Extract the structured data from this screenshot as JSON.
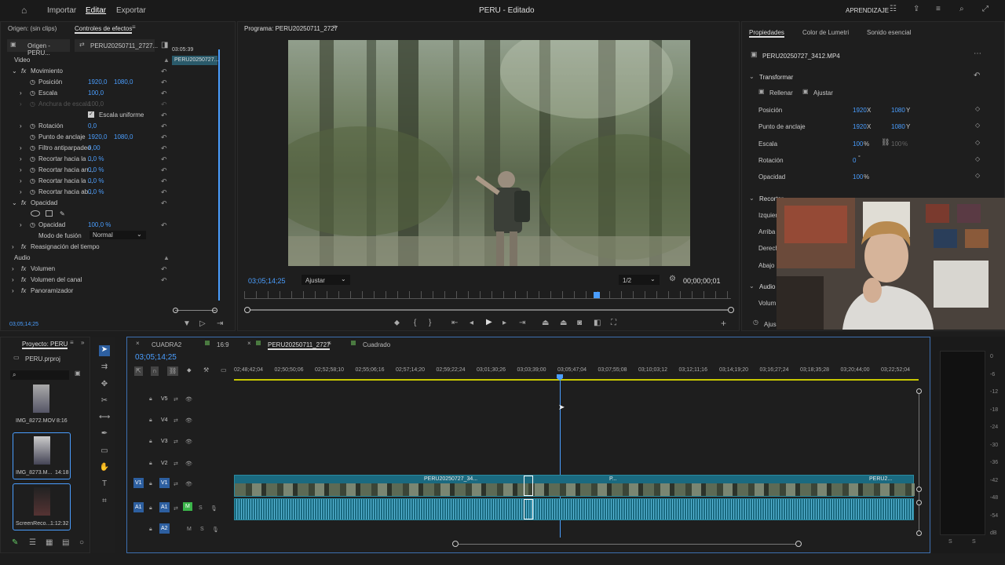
{
  "topbar": {
    "home_icon": "home-icon",
    "menu_import": "Importar",
    "menu_edit": "Editar",
    "menu_export": "Exportar",
    "title": "PERU - Editado",
    "learning": "APRENDIZAJE"
  },
  "source_panel": {
    "origin": "Origen: (sin clips)",
    "tab_effects": "Controles de efectos",
    "tab_source": "Origen - PERU...",
    "tab_seq": "PERU20250711_2727...",
    "mini_time": "03:05:39",
    "mini_clip": "PERU20250727...",
    "video_label": "Video",
    "movement": "Movimiento",
    "position": "Posición",
    "pos_x": "1920,0",
    "pos_y": "1080,0",
    "scale": "Escala",
    "scale_val": "100,0",
    "width_scale": "Anchura de escala",
    "width_val": "100,0",
    "uniform_scale": "Escala uniforme",
    "rotation": "Rotación",
    "rotation_val": "0,0",
    "anchor": "Punto de anclaje",
    "anchor_x": "1920,0",
    "anchor_y": "1080,0",
    "antiflicker": "Filtro antiparpadeo",
    "antiflicker_val": "0,00",
    "crop_left": "Recortar hacia la ...",
    "crop_left_val": "0,0 %",
    "crop_right": "Recortar hacia arr...",
    "crop_right_val": "0,0 %",
    "crop_top": "Recortar hacia la ...",
    "crop_top_val": "0,0 %",
    "crop_bottom": "Recortar hacia ab...",
    "crop_bottom_val": "0,0 %",
    "opacity_group": "Opacidad",
    "opacity": "Opacidad",
    "opacity_val": "100,0 %",
    "blend_mode": "Modo de fusión",
    "blend_val": "Normal",
    "time_remap": "Reasignación del tiempo",
    "audio_label": "Audio",
    "volume": "Volumen",
    "channel_volume": "Volumen del canal",
    "panner": "Panoramizador",
    "timecode": "03;05;14;25"
  },
  "program": {
    "title": "Programa: PERU20250711_2727",
    "timecode": "03;05;14;25",
    "fit": "Ajustar",
    "resolution": "1/2",
    "duration": "00;00;00;01"
  },
  "props": {
    "tab_props": "Propiedades",
    "tab_lumetri": "Color de Lumetri",
    "tab_sound": "Sonido esencial",
    "clip": "PERU20250727_3412.MP4",
    "transform": "Transformar",
    "fill": "Rellenar",
    "fit": "Ajustar",
    "position": "Posición",
    "pos_x": "1920",
    "pos_y": "1080",
    "anchor": "Punto de anclaje",
    "anchor_x": "1920",
    "anchor_y": "1080",
    "scale": "Escala",
    "scale_val": "100",
    "scale_val2": "100",
    "rotation": "Rotación",
    "rotation_val": "0",
    "opacity": "Opacidad",
    "opacity_val": "100",
    "crop": "Recortar",
    "crop_left": "Izquier",
    "crop_top": "Arriba",
    "crop_right": "Derech",
    "crop_bottom": "Abajo",
    "audio": "Audio",
    "volume": "Volum",
    "adjust": "Ajus",
    "x": "X",
    "y": "Y",
    "pct": "%"
  },
  "project": {
    "title": "Proyecto: PERU",
    "file": "PERU.prproj",
    "items": [
      {
        "name": "IMG_8272.MOV",
        "dur": "8:16"
      },
      {
        "name": "IMG_8273.M...",
        "dur": "14:18"
      },
      {
        "name": "ScreenReco...",
        "dur": "1:12:32"
      }
    ]
  },
  "timeline": {
    "tabs": [
      "CUADRA2",
      "16:9",
      "PERU20250711_2727",
      "Cuadrado"
    ],
    "timecode": "03;05;14;25",
    "ruler": [
      "02;48;42;04",
      "02;50;50;06",
      "02;52;58;10",
      "02;55;06;16",
      "02;57;14;20",
      "02;59;22;24",
      "03;01;30;26",
      "03;03;39;00",
      "03;05;47;04",
      "03;07;55;08",
      "03;10;03;12",
      "03;12;11;16",
      "03;14;19;20",
      "03;16;27;24",
      "03;18;35;28",
      "03;20;44;00",
      "03;22;52;04"
    ],
    "tracks": {
      "v5": "V5",
      "v4": "V4",
      "v3": "V3",
      "v2": "V2",
      "v1": "V1",
      "a1": "A1",
      "a2": "A2"
    },
    "clip1": "PERU20250727_34...",
    "clip2": "P...",
    "clip3": "PERU2..."
  },
  "meter": {
    "labels": [
      "0",
      "-6",
      "-12",
      "-18",
      "-24",
      "-30",
      "-36",
      "-42",
      "-48",
      "-54",
      "dB"
    ],
    "s1": "S",
    "s2": "S"
  }
}
